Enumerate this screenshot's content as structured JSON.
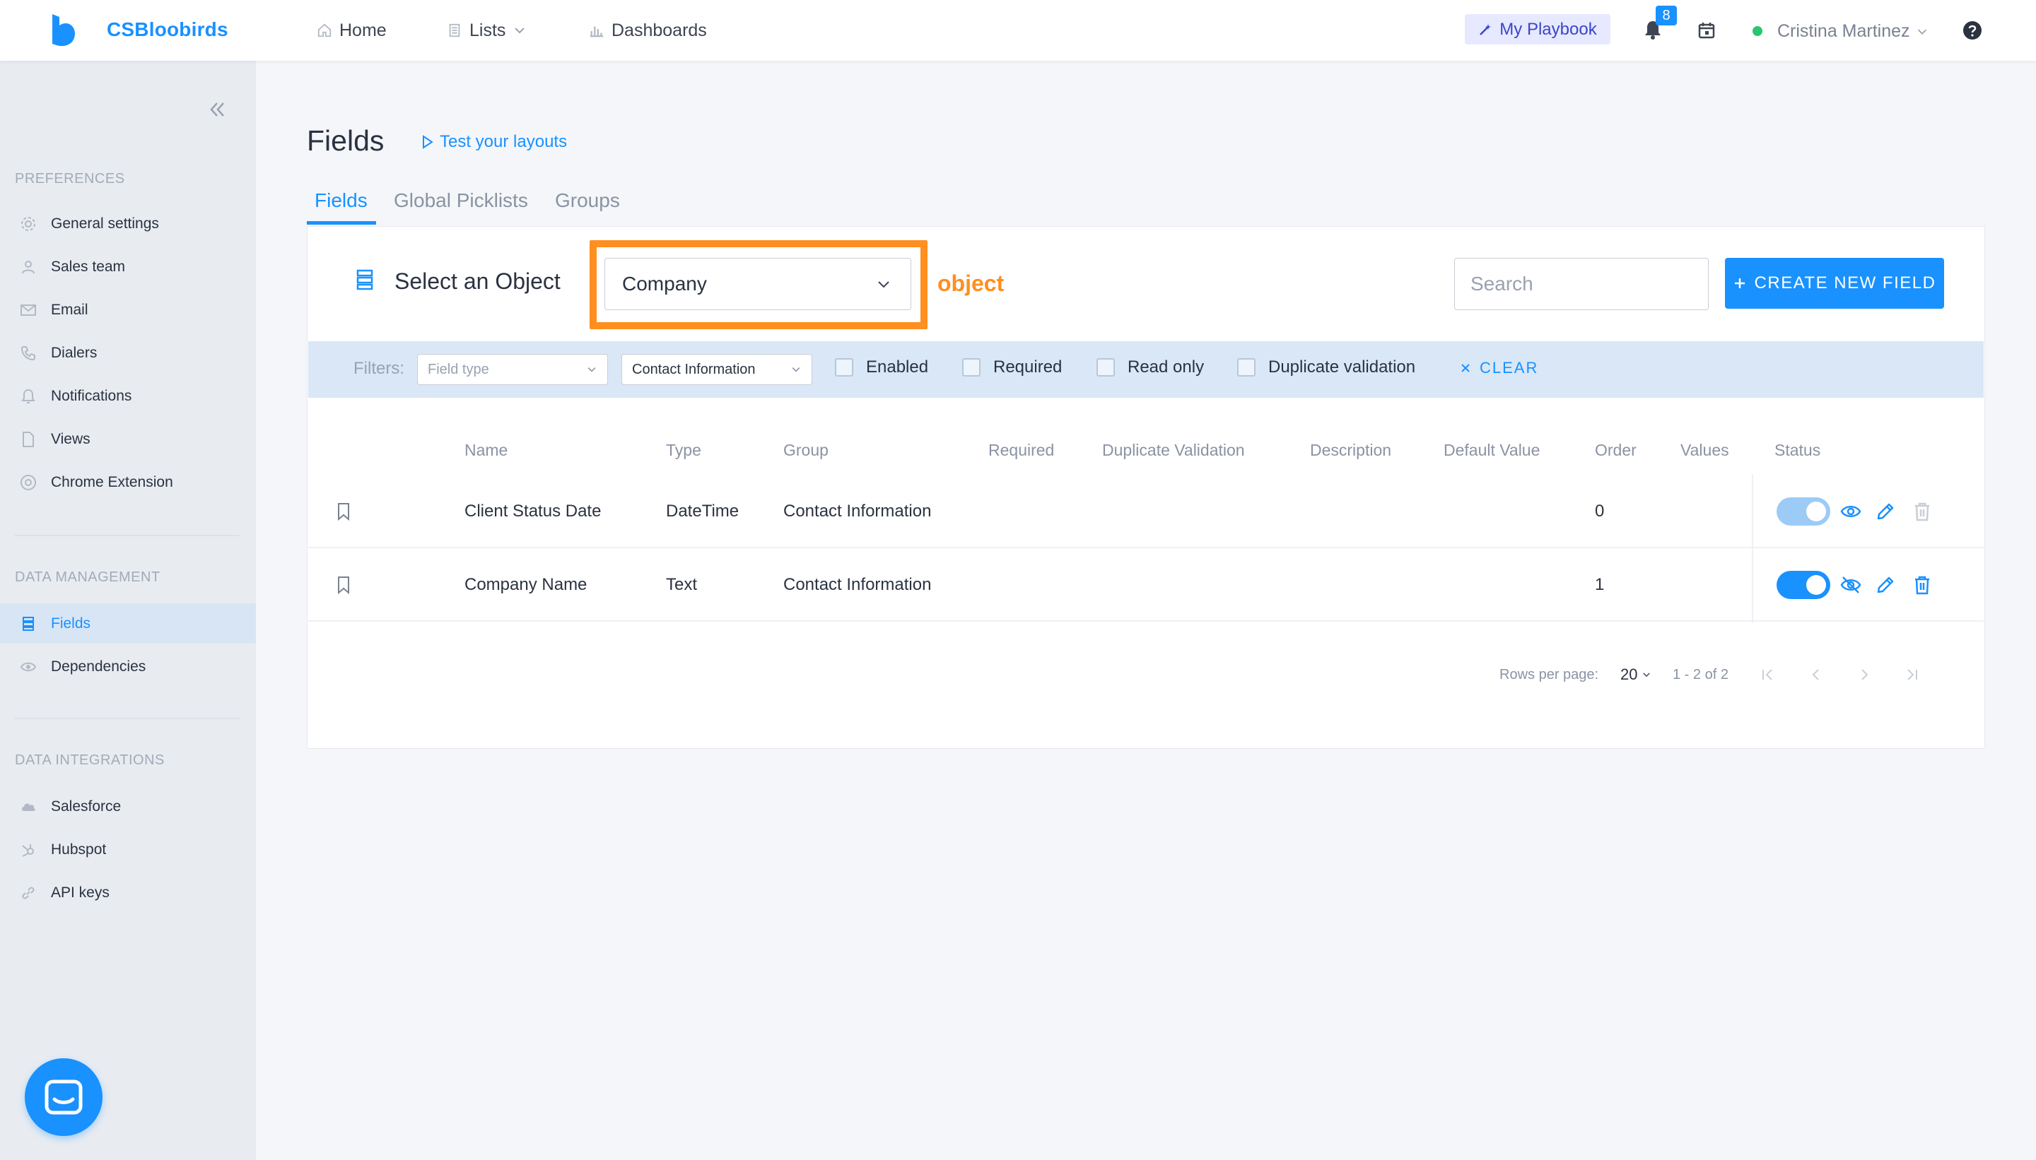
{
  "topbar": {
    "brand": "CSBloobirds",
    "nav": {
      "home": "Home",
      "lists": "Lists",
      "dashboards": "Dashboards"
    },
    "playbook": "My Playbook",
    "notification_count": "8",
    "user_name": "Cristina Martinez"
  },
  "sidebar": {
    "preferences_title": "PREFERENCES",
    "preferences": [
      {
        "label": "General settings",
        "icon": "gear-icon"
      },
      {
        "label": "Sales team",
        "icon": "user-icon"
      },
      {
        "label": "Email",
        "icon": "mail-icon"
      },
      {
        "label": "Dialers",
        "icon": "phone-icon"
      },
      {
        "label": "Notifications",
        "icon": "bell-icon"
      },
      {
        "label": "Views",
        "icon": "file-icon"
      },
      {
        "label": "Chrome Extension",
        "icon": "chrome-icon"
      }
    ],
    "data_management_title": "DATA MANAGEMENT",
    "data_management": [
      {
        "label": "Fields",
        "icon": "list-icon",
        "active": true
      },
      {
        "label": "Dependencies",
        "icon": "eye-icon"
      }
    ],
    "data_integrations_title": "DATA INTEGRATIONS",
    "data_integrations": [
      {
        "label": "Salesforce",
        "icon": "cloud-icon"
      },
      {
        "label": "Hubspot",
        "icon": "hubspot-icon"
      },
      {
        "label": "API keys",
        "icon": "link-icon"
      }
    ]
  },
  "page": {
    "title": "Fields",
    "test_layouts": "Test your layouts",
    "tabs": [
      "Fields",
      "Global Picklists",
      "Groups"
    ],
    "active_tab": "Fields"
  },
  "object_select": {
    "label": "Select an Object",
    "value": "Company",
    "annotation": "object"
  },
  "search": {
    "placeholder": "Search"
  },
  "create_button": "CREATE NEW FIELD",
  "filters": {
    "label": "Filters:",
    "field_type_placeholder": "Field type",
    "group_value": "Contact Information",
    "checkboxes": [
      "Enabled",
      "Required",
      "Read only",
      "Duplicate validation"
    ],
    "clear": "CLEAR"
  },
  "table": {
    "columns": [
      "Name",
      "Type",
      "Group",
      "Required",
      "Duplicate Validation",
      "Description",
      "Default Value",
      "Order",
      "Values",
      "Status"
    ],
    "rows": [
      {
        "name": "Client Status Date",
        "type": "DateTime",
        "group": "Contact Information",
        "required": "",
        "duplicate_validation": "",
        "description": "",
        "default_value": "",
        "order": "0",
        "values": "",
        "enabled": true,
        "visible": true
      },
      {
        "name": "Company Name",
        "type": "Text",
        "group": "Contact Information",
        "required": "",
        "duplicate_validation": "",
        "description": "",
        "default_value": "",
        "order": "1",
        "values": "",
        "enabled": true,
        "visible": false
      }
    ]
  },
  "pagination": {
    "rows_per_page_label": "Rows per page:",
    "rows_per_page": "20",
    "range": "1 - 2 of 2"
  },
  "colors": {
    "accent": "#1991ff",
    "highlight": "#ff8f1f",
    "toggle_disabled": "#9ccbf5",
    "online": "#28c76f"
  }
}
